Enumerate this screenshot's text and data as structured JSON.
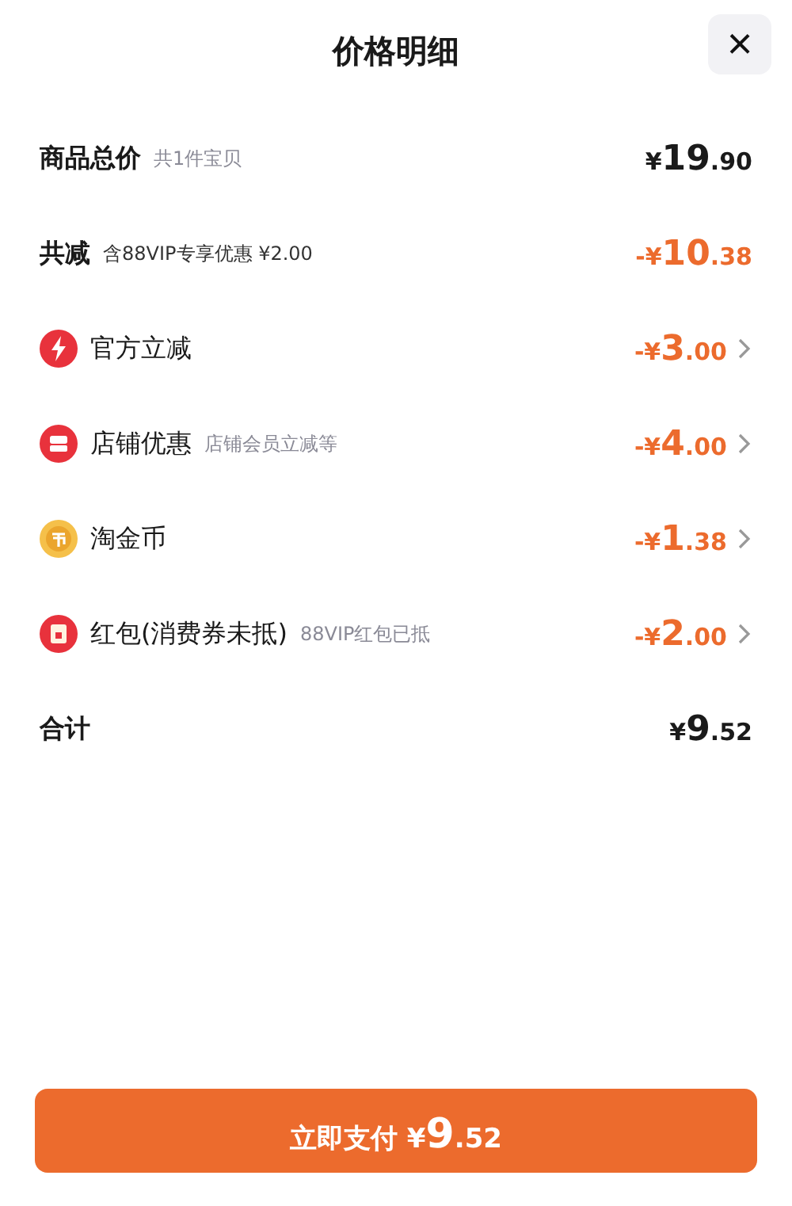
{
  "header": {
    "title": "价格明细",
    "close": "×"
  },
  "rows": [
    {
      "kind": "total",
      "label": "商品总价",
      "note": "共1件宝贝",
      "price": {
        "prefix": "¥",
        "whole": "19",
        "fraction": ".90"
      }
    },
    {
      "kind": "summary",
      "label": "共减",
      "note": "含88VIP专享优惠 ¥2.00",
      "price": {
        "prefix": "-¥",
        "whole": "10",
        "fraction": ".38"
      }
    },
    {
      "kind": "flash",
      "label": "官方立减",
      "price": {
        "prefix": "-¥",
        "whole": "3",
        "fraction": ".00"
      }
    },
    {
      "kind": "shop",
      "label": "店铺优惠",
      "note": "店铺会员立减等",
      "price": {
        "prefix": "-¥",
        "whole": "4",
        "fraction": ".00"
      }
    },
    {
      "kind": "coin",
      "label": "淘金币",
      "price": {
        "prefix": "-¥",
        "whole": "1",
        "fraction": ".38"
      }
    },
    {
      "kind": "packet",
      "label": "红包(消费券未抵)",
      "note": "88VIP红包已抵",
      "price": {
        "prefix": "-¥",
        "whole": "2",
        "fraction": ".00"
      }
    },
    {
      "kind": "total",
      "label": "合计",
      "price": {
        "prefix": "¥",
        "whole": "9",
        "fraction": ".52"
      }
    }
  ],
  "pay_button": {
    "label": "立即支付",
    "price": {
      "prefix": "¥",
      "whole": "9",
      "fraction": ".52"
    }
  }
}
